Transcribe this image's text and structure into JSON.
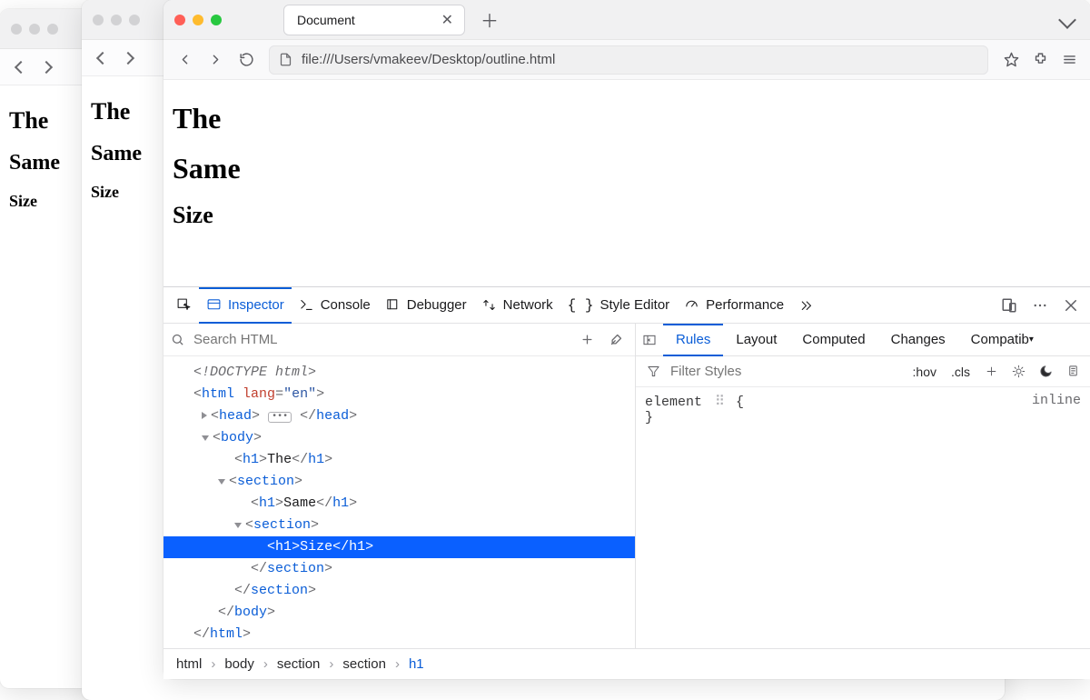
{
  "tab": {
    "title": "Document"
  },
  "toolbar": {
    "url": "file:///Users/vmakeev/Desktop/outline.html"
  },
  "page": {
    "h1": "The",
    "h2": "Same",
    "h3": "Size"
  },
  "devtools": {
    "tabs": {
      "inspector": "Inspector",
      "console": "Console",
      "debugger": "Debugger",
      "network": "Network",
      "styleeditor": "Style Editor",
      "performance": "Performance"
    },
    "search_placeholder": "Search HTML",
    "tree": {
      "doctype_label": "<!DOCTYPE html>",
      "html_open_1": "<",
      "html_tag": "html",
      "html_attr": " lang",
      "html_eq": "=",
      "html_val": "\"en\"",
      "html_open_2": ">",
      "head_tag": "head",
      "body_tag": "body",
      "section_tag": "section",
      "h1_tag": "h1",
      "the": "The",
      "same": "Same",
      "size": "Size",
      "lt": "<",
      "gt": ">",
      "slash": "</",
      "sgt": ">"
    },
    "breadcrumbs": [
      "html",
      "body",
      "section",
      "section",
      "h1"
    ],
    "rules": {
      "tabs": {
        "rules": "Rules",
        "layout": "Layout",
        "computed": "Computed",
        "changes": "Changes",
        "compat": "Compatib"
      },
      "filter_placeholder": "Filter Styles",
      "hov": ":hov",
      "cls": ".cls",
      "element_label": "element",
      "brace_open": "{",
      "brace_close": "}",
      "inline_label": "inline"
    }
  }
}
